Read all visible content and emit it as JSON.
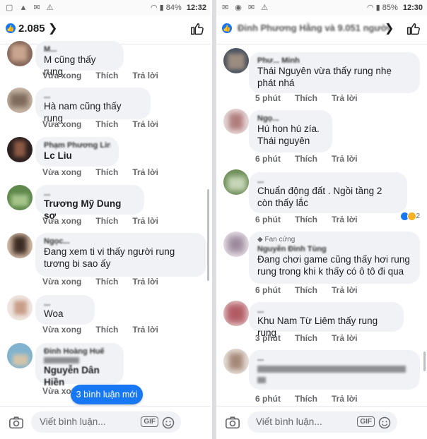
{
  "left": {
    "status": {
      "battery": "84%",
      "time": "12:32"
    },
    "reaction_count": "2.085",
    "comments": [
      {
        "name": "M...",
        "text": "M cũng thấy rung",
        "time": "Vừa xong"
      },
      {
        "name": "...",
        "text": "Hà nam cũng thấy rung",
        "time": "Vừa xong"
      },
      {
        "name": "Phạm Phương Linh",
        "text": "Lc Liu",
        "time": "Vừa xong"
      },
      {
        "name": "...",
        "text": "Trương Mỹ Dung sợ",
        "time": "Vừa xong"
      },
      {
        "name": "Ngọc...",
        "text": "Đang xem ti vi thấy người rung tương bi sao ấy",
        "time": "Vừa xong"
      },
      {
        "name": "...",
        "text": "Woa",
        "time": "Vừa xong"
      },
      {
        "name": "Đinh Hoàng Huế",
        "text": "Nguyễn Dân Hiền",
        "time": "Vừa xong"
      }
    ],
    "new_comments_label": "3 bình luận mới"
  },
  "right": {
    "status": {
      "battery": "85%",
      "time": "12:30"
    },
    "header_name": "Đinh Phương Hằng và 9.051 người",
    "comments": [
      {
        "name": "Phư... Minh",
        "badge": "",
        "text": "Thái Nguyên vừa thấy rung nhẹ phát nhá",
        "time": "5 phút"
      },
      {
        "name": "Ngọ...",
        "badge": "",
        "text": "Hú hon hú zía. Thái nguyên",
        "time": "6 phút"
      },
      {
        "name": "...",
        "badge": "",
        "text": "Chuẩn động đất . Ngồi tầng 2 còn thấy lắc",
        "time": "6 phút",
        "reactions": "2"
      },
      {
        "name": "Nguyễn Đình Tùng",
        "badge": "Fan cứng",
        "text": "Đang chơi game cũng thấy hơi rung rung trong khi k thấy có ô tô đi qua",
        "time": "6 phút"
      },
      {
        "name": "...",
        "badge": "",
        "text": "Khu Nam Từ Liêm thấy rung rung",
        "time": "3 phút"
      },
      {
        "name": "...",
        "badge": "",
        "text": "...",
        "time": "6 phút"
      }
    ]
  },
  "labels": {
    "like": "Thích",
    "reply": "Trả lời",
    "composer_placeholder": "Viết bình luận...",
    "gif": "GIF"
  },
  "colors": {
    "accent": "#1877f2",
    "bubble": "#f0f2f5"
  }
}
